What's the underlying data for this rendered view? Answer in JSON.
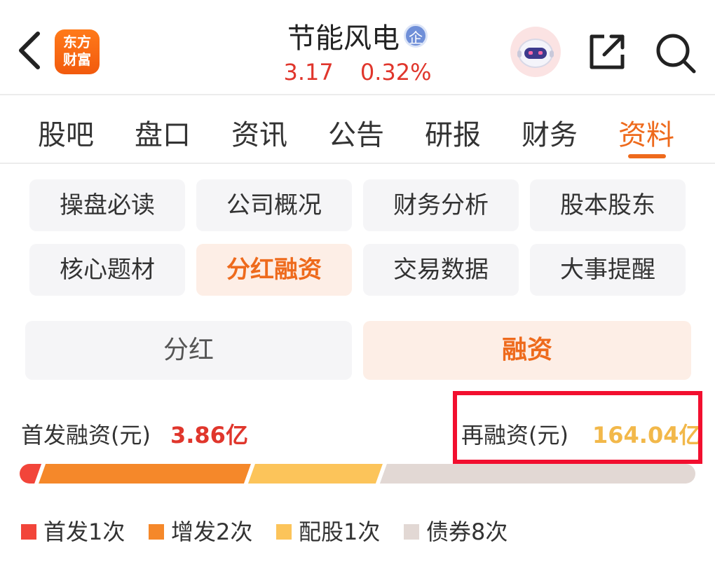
{
  "header": {
    "logo_line1": "东方",
    "logo_line2": "财富",
    "stock_name": "节能风电",
    "badge": "企",
    "price": "3.17",
    "change_pct": "0.32%"
  },
  "tabs": [
    {
      "label": "股吧"
    },
    {
      "label": "盘口"
    },
    {
      "label": "资讯"
    },
    {
      "label": "公告"
    },
    {
      "label": "研报"
    },
    {
      "label": "财务"
    },
    {
      "label": "资料",
      "active": true
    }
  ],
  "categories": [
    {
      "label": "操盘必读"
    },
    {
      "label": "公司概况"
    },
    {
      "label": "财务分析"
    },
    {
      "label": "股本股东"
    },
    {
      "label": "核心题材"
    },
    {
      "label": "分红融资",
      "active": true
    },
    {
      "label": "交易数据"
    },
    {
      "label": "大事提醒"
    }
  ],
  "sub_tabs": {
    "dividend": "分红",
    "financing": "融资",
    "active": "融资"
  },
  "financing": {
    "ipo_label": "首发融资(元)",
    "ipo_value": "3.86亿",
    "refinance_label": "再融资(元)",
    "refinance_value": "164.04亿"
  },
  "breakdown": {
    "segments": [
      {
        "name": "首发",
        "share": 0.025,
        "color": "#f2453a"
      },
      {
        "name": "增发",
        "share": 0.31,
        "color": "#f5882a"
      },
      {
        "name": "配股",
        "share": 0.195,
        "color": "#fcc45a"
      },
      {
        "name": "债券",
        "share": 0.47,
        "color": "#e2d8d4"
      }
    ]
  },
  "legend": [
    {
      "label": "首发1次",
      "color": "#f2453a"
    },
    {
      "label": "增发2次",
      "color": "#f5882a"
    },
    {
      "label": "配股1次",
      "color": "#fcc45a"
    },
    {
      "label": "债券8次",
      "color": "#e2d8d4"
    }
  ]
}
